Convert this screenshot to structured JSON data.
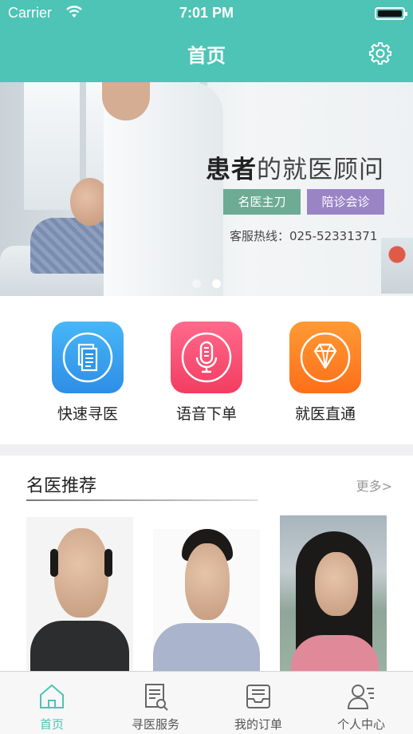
{
  "status_bar": {
    "carrier": "Carrier",
    "time": "7:01 PM"
  },
  "nav": {
    "title": "首页",
    "settings_icon": "gear-icon"
  },
  "banner": {
    "slogan_bold": "患者",
    "slogan_rest": "的就医顾问",
    "tags": [
      "名医主刀",
      "陪诊会诊"
    ],
    "hotline": "客服热线：025-52331371",
    "page_count": 2,
    "active_page": 2
  },
  "actions": [
    {
      "label": "快速寻医",
      "icon": "document-icon",
      "color": "#2d8ee6"
    },
    {
      "label": "语音下单",
      "icon": "microphone-icon",
      "color": "#f23d61"
    },
    {
      "label": "就医直通",
      "icon": "diamond-icon",
      "color": "#fd6f19"
    }
  ],
  "doctors_section": {
    "title": "名医推荐",
    "more": "更多>"
  },
  "tabbar": {
    "items": [
      {
        "label": "首页",
        "icon": "home-icon",
        "active": true
      },
      {
        "label": "寻医服务",
        "icon": "search-document-icon",
        "active": false
      },
      {
        "label": "我的订单",
        "icon": "inbox-icon",
        "active": false
      },
      {
        "label": "个人中心",
        "icon": "profile-icon",
        "active": false
      }
    ],
    "active_color": "#4dc4b5"
  },
  "colors": {
    "theme": "#4dc4b5"
  }
}
